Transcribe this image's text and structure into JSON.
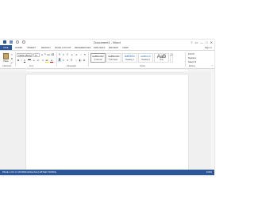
{
  "window": {
    "title": "Document1 - Word",
    "controls": [
      "?",
      "▭",
      "—",
      "□",
      "✕"
    ]
  },
  "tabs": [
    "FILE",
    "HOME",
    "INSERT",
    "DESIGN",
    "PAGE LAYOUT",
    "REFERENCES",
    "MAILINGS",
    "REVIEW",
    "VIEW"
  ],
  "signin": "Sign in",
  "ribbon": {
    "clipboard_label": "Clipboard",
    "font_label": "Font",
    "paragraph_label": "Paragraph",
    "styles_label": "Styles",
    "editing_label": "Editing",
    "paste_label": "Paste",
    "font_name": "Calibri (Body)",
    "font_size": "11",
    "styles": [
      {
        "sample": "AaBbCcDc",
        "name": "¶ Normal"
      },
      {
        "sample": "AaBbCcDc",
        "name": "¶ No Spac..."
      },
      {
        "sample": "AaBbCc",
        "name": "Heading 1"
      },
      {
        "sample": "AaBbCcC",
        "name": "Heading 2"
      },
      {
        "sample": "AaB",
        "name": "Title"
      }
    ],
    "editing": [
      "Find ▾",
      "Replace",
      "Select ▾"
    ],
    "icons": {
      "bold": "B",
      "italic": "I",
      "underline": "U",
      "strike": "abc",
      "subscript": "x₂",
      "superscript": "x²",
      "font_color": "A",
      "bullets": "☰",
      "numbering": "≡",
      "indent": "⇥",
      "sort": "↕",
      "pilcrow": "¶"
    }
  },
  "status": {
    "left": "PAGE 1 OF 1    0 WORDS    ENGLISH (UNITED STATES)",
    "right": "100%"
  },
  "colors": {
    "accent": "#2b579a"
  }
}
